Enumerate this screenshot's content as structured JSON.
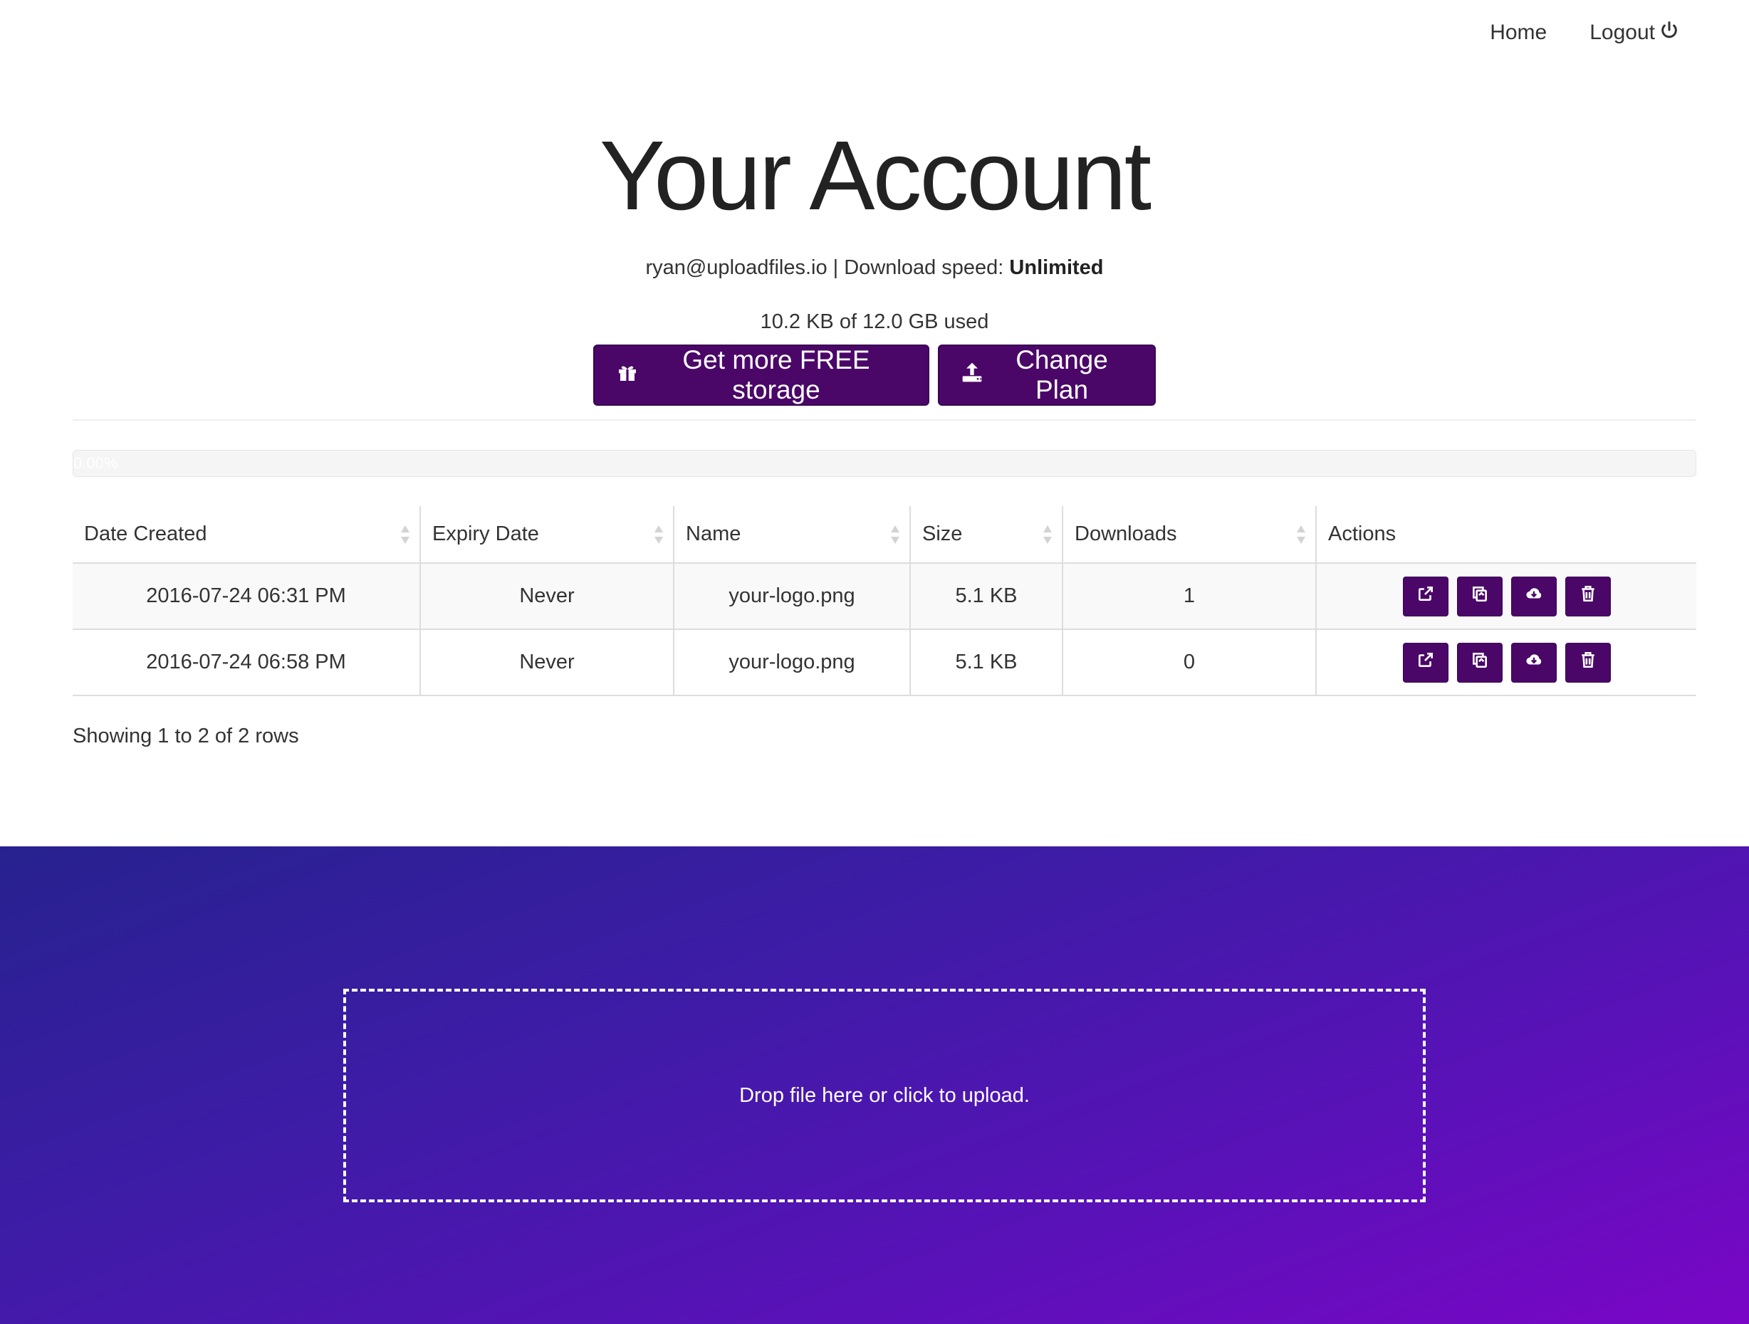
{
  "nav": {
    "home": "Home",
    "logout": "Logout"
  },
  "header": {
    "title": "Your Account",
    "email": "ryan@uploadfiles.io",
    "speed_label": " | Download speed: ",
    "speed_value": "Unlimited",
    "usage": "10.2 KB of 12.0 GB used"
  },
  "buttons": {
    "free_storage": "Get more FREE storage",
    "change_plan": "Change Plan"
  },
  "progress": {
    "label": "0.00%",
    "percent": 0
  },
  "table": {
    "columns": [
      "Date Created",
      "Expiry Date",
      "Name",
      "Size",
      "Downloads",
      "Actions"
    ],
    "rows": [
      {
        "date_created": "2016-07-24 06:31 PM",
        "expiry": "Never",
        "name": "your-logo.png",
        "size": "5.1 KB",
        "downloads": "1"
      },
      {
        "date_created": "2016-07-24 06:58 PM",
        "expiry": "Never",
        "name": "your-logo.png",
        "size": "5.1 KB",
        "downloads": "0"
      }
    ],
    "action_icons": [
      "external-link-icon",
      "copy-icon",
      "cloud-download-icon",
      "trash-icon"
    ]
  },
  "pagination": {
    "info": "Showing 1 to 2 of 2 rows"
  },
  "upload": {
    "prompt": "Drop file here or click to upload."
  },
  "colors": {
    "accent": "#4a0768",
    "gradient_start": "#27218f",
    "gradient_end": "#7a06c6"
  }
}
